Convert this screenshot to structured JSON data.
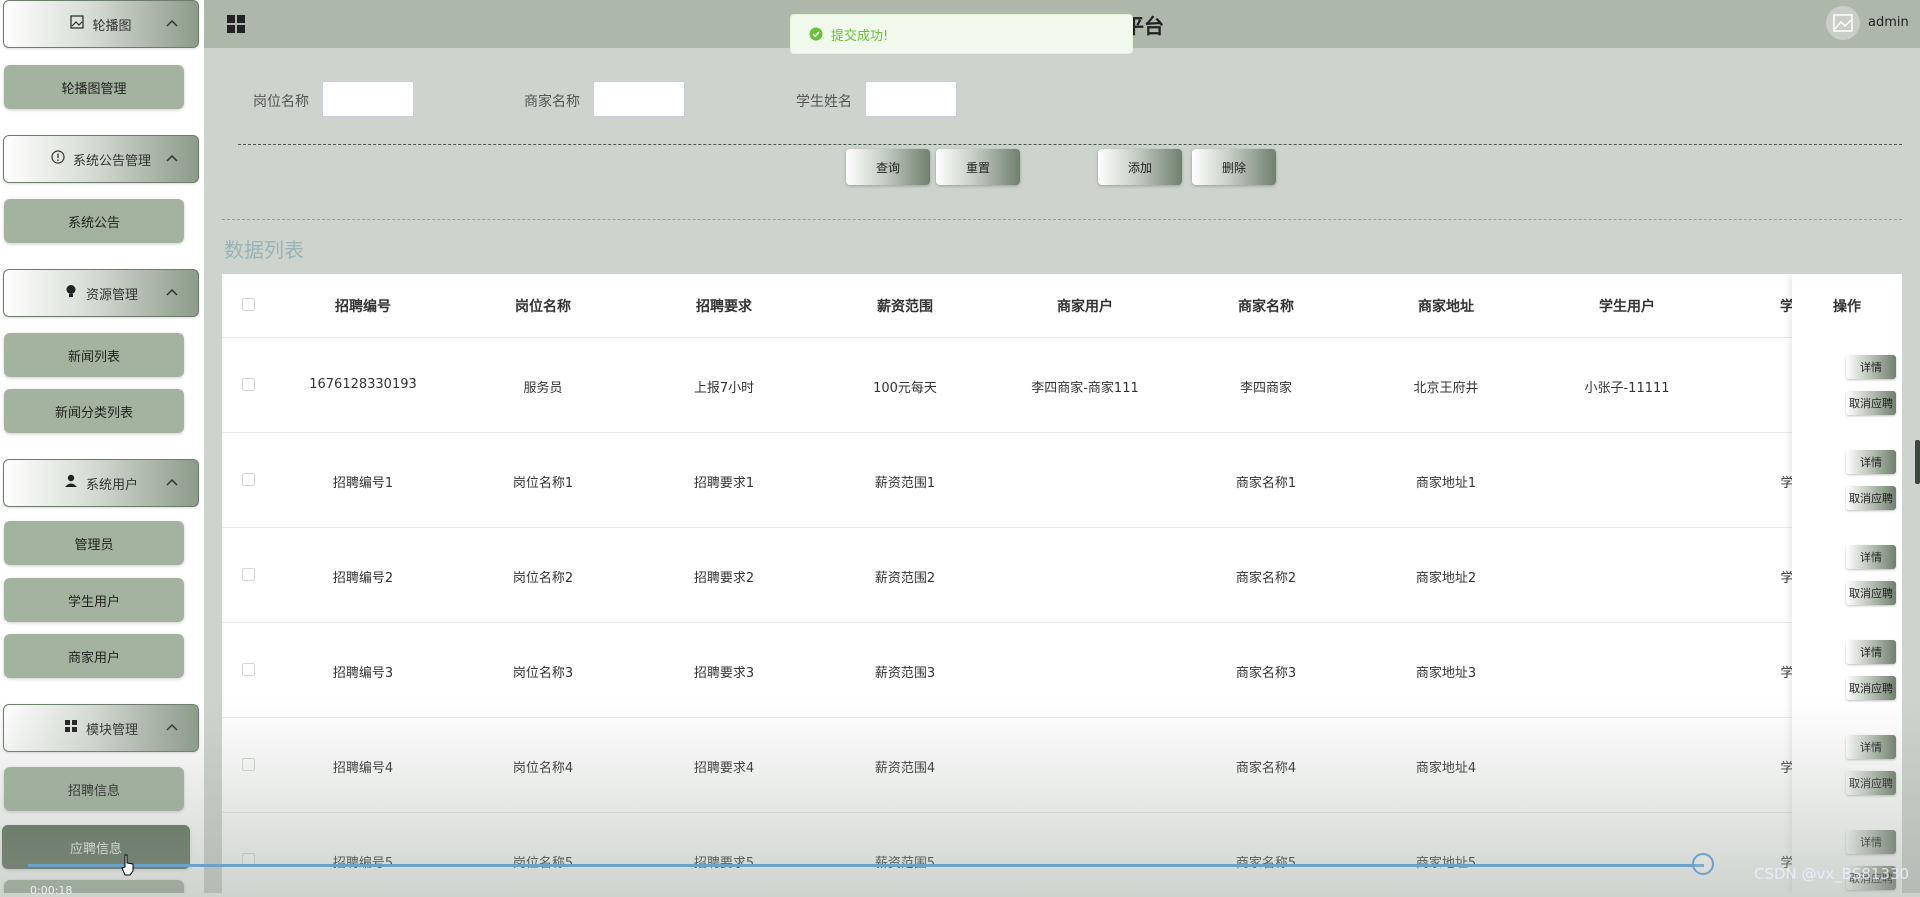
{
  "topbar": {
    "title": "平台",
    "username": "admin"
  },
  "toast": {
    "message": "提交成功!"
  },
  "sidebar": {
    "groups": [
      {
        "label": "轮播图",
        "icon": "image-icon",
        "items": [
          "轮播图管理"
        ]
      },
      {
        "label": "系统公告管理",
        "icon": "info-circle-icon",
        "items": [
          "系统公告"
        ]
      },
      {
        "label": "资源管理",
        "icon": "lightbulb-icon",
        "items": [
          "新闻列表",
          "新闻分类列表"
        ]
      },
      {
        "label": "系统用户",
        "icon": "user-icon",
        "items": [
          "管理员",
          "学生用户",
          "商家用户"
        ]
      },
      {
        "label": "模块管理",
        "icon": "grid-icon",
        "items": [
          "招聘信息",
          "应聘信息"
        ]
      }
    ]
  },
  "search": {
    "fields": [
      {
        "label": "岗位名称"
      },
      {
        "label": "商家名称"
      },
      {
        "label": "学生姓名"
      }
    ],
    "buttons": {
      "query": "查询",
      "reset": "重置",
      "add": "添加",
      "delete": "删除"
    }
  },
  "list": {
    "title": "数据列表"
  },
  "table": {
    "columns": [
      "招聘编号",
      "岗位名称",
      "招聘要求",
      "薪资范围",
      "商家用户",
      "商家名称",
      "商家地址",
      "学生用户",
      "学",
      "操作"
    ],
    "rows": [
      [
        "1676128330193",
        "服务员",
        "上报7小时",
        "100元每天",
        "李四商家-商家111",
        "李四商家",
        "北京王府井",
        "小张子-11111",
        ""
      ],
      [
        "招聘编号1",
        "岗位名称1",
        "招聘要求1",
        "薪资范围1",
        "",
        "商家名称1",
        "商家地址1",
        "",
        "学"
      ],
      [
        "招聘编号2",
        "岗位名称2",
        "招聘要求2",
        "薪资范围2",
        "",
        "商家名称2",
        "商家地址2",
        "",
        "学"
      ],
      [
        "招聘编号3",
        "岗位名称3",
        "招聘要求3",
        "薪资范围3",
        "",
        "商家名称3",
        "商家地址3",
        "",
        "学"
      ],
      [
        "招聘编号4",
        "岗位名称4",
        "招聘要求4",
        "薪资范围4",
        "",
        "商家名称4",
        "商家地址4",
        "",
        "学"
      ],
      [
        "招聘编号5",
        "岗位名称5",
        "招聘要求5",
        "薪资范围5",
        "",
        "商家名称5",
        "商家地址5",
        "",
        "学"
      ]
    ],
    "ops": {
      "detail": "详情",
      "cancel": "取消应聘"
    }
  },
  "video": {
    "time": "0:00:18",
    "watermark": "CSDN @vx_BS81330"
  }
}
